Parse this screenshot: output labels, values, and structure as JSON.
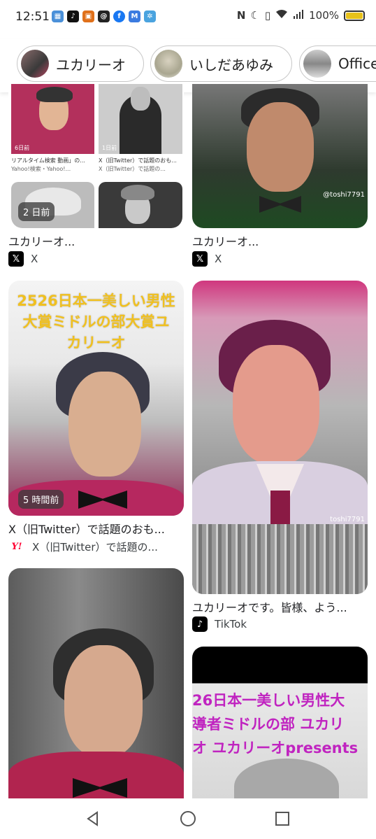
{
  "status_bar": {
    "time": "12:51",
    "battery": "100%",
    "app_icons": [
      "calendar-icon",
      "tiktok-icon",
      "shop-icon",
      "threads-icon",
      "facebook-icon",
      "mail-icon",
      "translate-icon"
    ],
    "right_icons": [
      "nfc-icon",
      "moon-icon",
      "vibrate-icon",
      "wifi-icon",
      "signal-icon"
    ]
  },
  "chips": [
    {
      "label": "ユカリーオ"
    },
    {
      "label": "いしだあゆみ"
    },
    {
      "label": "Office"
    }
  ],
  "results": {
    "card1": {
      "title": "ユカリーオ...",
      "source": "X",
      "time_badge": "2 日前",
      "sub_texts": [
        "6日前",
        "リアルタイム検索 動画」の...",
        "Yahoo!検索・Yahoo!...",
        "1日前",
        "X（旧Twitter）で話題のおも...",
        "X（旧Twitter）で話題の..."
      ]
    },
    "card2": {
      "title": "ユカリーオ...",
      "source": "X",
      "watermark": "@toshi7791"
    },
    "card3": {
      "title": "X（旧Twitter）で話題のおも...",
      "source": "X（旧Twitter）で話題の...",
      "time_badge": "5 時間前",
      "overlay": [
        "2526日本一美しい男性",
        "大賞ミドルの部大賞ユ",
        "カリーオ"
      ]
    },
    "card4": {
      "title": "ユカリーオです。皆様、よう...",
      "source": "TikTok",
      "watermark": "toshi7791"
    },
    "card6": {
      "overlay": [
        "26日本一美しい男性大",
        "導者ミドルの部 ユカリ",
        "オ ユカリーオpresents"
      ]
    }
  },
  "nav": {
    "back": "back-icon",
    "home": "home-icon",
    "recents": "recents-icon"
  }
}
